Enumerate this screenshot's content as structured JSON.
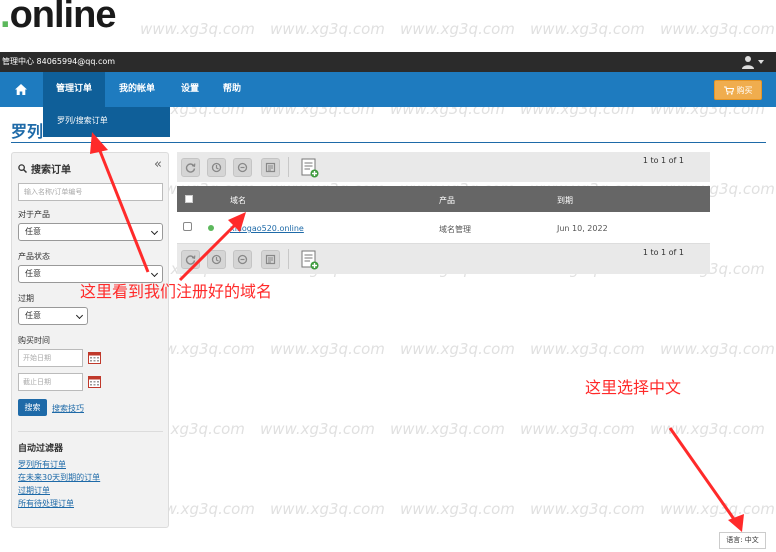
{
  "brand": {
    "logo_dot": ".",
    "logo_text": "online"
  },
  "topbar": {
    "account_text": "管理中心 84065994@qq.com"
  },
  "nav": {
    "items": [
      {
        "label": "管理订单"
      },
      {
        "label": "我的帐单"
      },
      {
        "label": "设置"
      },
      {
        "label": "帮助"
      }
    ],
    "buy_label": "购买",
    "dropdown_item": "罗列/搜索订单"
  },
  "page": {
    "title": "罗列"
  },
  "sidebar": {
    "heading": "搜索订单",
    "collapse_icon": "«",
    "search_placeholder": "输入名称/订单编号",
    "product_label": "对于产品",
    "product_value": "任意",
    "status_label": "产品状态",
    "status_value": "任意",
    "expiry_label": "过期",
    "expiry_value": "任意",
    "purchase_label": "购买时间",
    "start_placeholder": "开始日期",
    "end_placeholder": "截止日期",
    "search_button": "搜索",
    "search_tips": "搜索技巧",
    "filters_title": "自动过滤器",
    "filters": [
      "罗列所有订单",
      "在未来30天到期的订单",
      "过期订单",
      "所有待处理订单"
    ]
  },
  "table": {
    "pager_top": "1 to 1 of 1",
    "pager_bottom": "1 to 1 of 1",
    "columns": [
      "域名",
      "产品",
      "到期"
    ],
    "rows": [
      {
        "domain": "xiaogao520.online",
        "product": "域名管理",
        "expiry": "Jun 10, 2022"
      }
    ]
  },
  "annotations": {
    "domain_note": "这里看到我们注册好的域名",
    "language_note": "这里选择中文"
  },
  "language_button": "语言: 中文",
  "watermark": "www.xg3q.com",
  "colors": {
    "nav_blue": "#1e7bbf",
    "nav_active": "#0f5f99",
    "title_blue": "#1e6aa8",
    "buy_orange": "#f0ad4e",
    "annotation_red": "#ff2a2a",
    "status_green": "#5cb85c"
  }
}
